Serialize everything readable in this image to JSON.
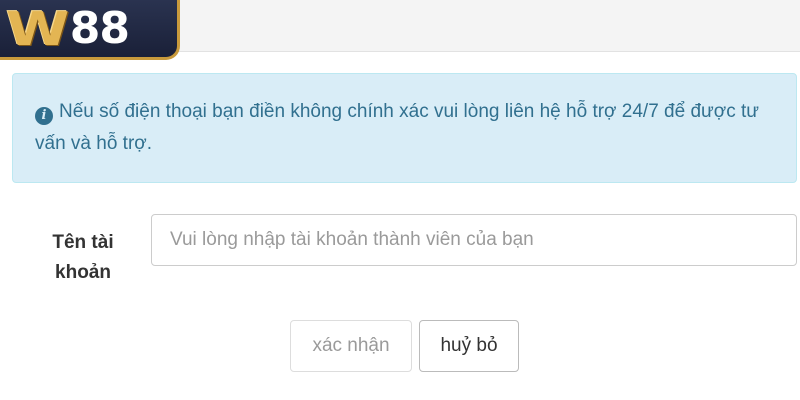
{
  "brand": {
    "logo_letter": "W",
    "logo_number": "88"
  },
  "alert": {
    "icon": "info-circle-icon",
    "text": "Nếu số điện thoại bạn điền không chính xác vui lòng liên hệ hỗ trợ 24/7 để được tư vấn và hỗ trợ."
  },
  "form": {
    "account_label_line1": "Tên tài",
    "account_label_line2": "khoản",
    "account_value": "",
    "account_placeholder": "Vui lòng nhập tài khoản thành viên của bạn"
  },
  "buttons": {
    "confirm_label": "xác nhận",
    "cancel_label": "huỷ bỏ"
  },
  "colors": {
    "alert_background": "#d9edf7",
    "alert_text": "#31708f",
    "logo_gold": "#e3b553",
    "logo_navy": "#1a2038"
  }
}
